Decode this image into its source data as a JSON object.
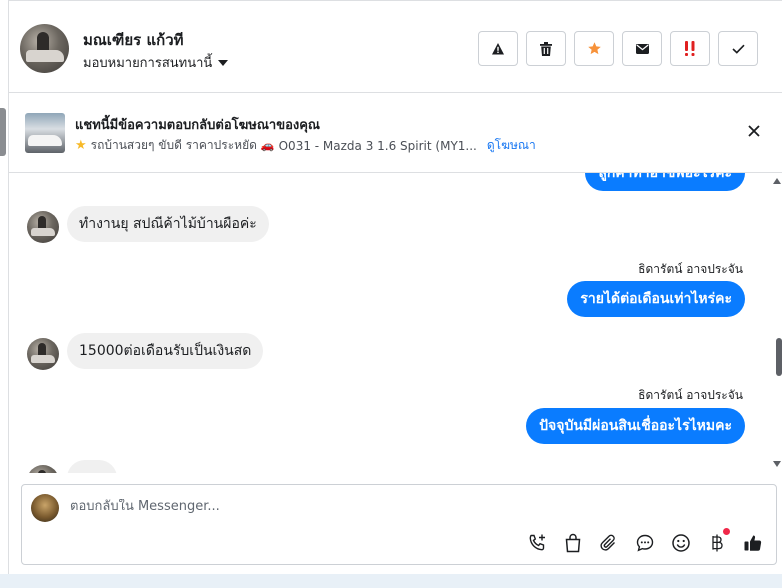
{
  "header": {
    "contact_name": "มณเฑียร แก้วที",
    "assign_label": "มอบหมายการสนทนานี้",
    "actions": [
      {
        "icon": "warning-icon"
      },
      {
        "icon": "trash-icon"
      },
      {
        "icon": "star-icon",
        "color": "#f7923a"
      },
      {
        "icon": "mail-icon"
      },
      {
        "icon": "follow-up-icon",
        "color": "#e02020"
      },
      {
        "icon": "check-icon"
      }
    ]
  },
  "banner": {
    "title": "แชทนี้มีข้อความตอบกลับต่อโฆษณาของคุณ",
    "subtitle_prefix": "รถบ้านสวยๆ ขับดี ราคาประหยัด",
    "subtitle_ad": "O031 - Mazda 3 1.6 Spirit (MY1...",
    "view_ad_link": "ดูโฆษณา"
  },
  "messages": [
    {
      "dir": "out",
      "text": "ลูกค้าทำอาชีพอะไรคะ"
    },
    {
      "dir": "in",
      "text": "ทำงานยุ  สปณีค้าไม้บ้านผือค่ะ"
    },
    {
      "dir": "out",
      "sender": "ธิดารัตน์ อาจประจัน",
      "text": "รายได้ต่อเดือนเท่าไหร่คะ"
    },
    {
      "dir": "in",
      "text": "15000ต่อเดือนรับเป็นเงินสด"
    },
    {
      "dir": "out",
      "sender": "ธิดารัตน์ อาจประจัน",
      "text": "ปัจจุบันมีผ่อนสินเชื่ออะไรไหมคะ"
    }
  ],
  "composer": {
    "placeholder": "ตอบกลับใน Messenger..."
  },
  "colors": {
    "accent": "#0a7cff",
    "incoming_bubble": "#f0f0f0"
  }
}
